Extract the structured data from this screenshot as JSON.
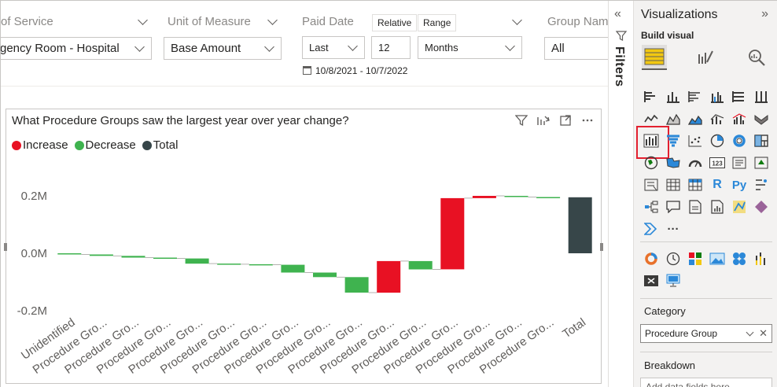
{
  "slicers": {
    "type_of_service": {
      "title": "of Service",
      "value": "gency Room - Hospital"
    },
    "unit_of_measure": {
      "title": "Unit of Measure",
      "value": "Base Amount"
    },
    "paid_date": {
      "title": "Paid Date",
      "toggle_relative": "Relative",
      "toggle_range": "Range",
      "period": "Last",
      "count": "12",
      "unit": "Months",
      "range_text": "10/8/2021 - 10/7/2022"
    },
    "group_name": {
      "title": "Group Nam",
      "value": "All"
    }
  },
  "visual": {
    "title": "What Procedure Groups saw the largest year over year change?",
    "legend": [
      {
        "label": "Increase",
        "color": "#e81123"
      },
      {
        "label": "Decrease",
        "color": "#3fb34f"
      },
      {
        "label": "Total",
        "color": "#374649"
      }
    ]
  },
  "chart_data": {
    "type": "waterfall",
    "title": "What Procedure Groups saw the largest year over year change?",
    "y_ticks": [
      "0.2M",
      "0.0M",
      "-0.2M"
    ],
    "ylim": [
      -0.2,
      0.2
    ],
    "categories": [
      "Unidentified",
      "Procedure Gro...",
      "Procedure Gro...",
      "Procedure Gro...",
      "Procedure Gro...",
      "Procedure Gro...",
      "Procedure Gro...",
      "Procedure Gro...",
      "Procedure Gro...",
      "Procedure Gro...",
      "Procedure Gro...",
      "Procedure Gro...",
      "Procedure Gro...",
      "Procedure Gro...",
      "Procedure Gro...",
      "Procedure Gro...",
      "Total"
    ],
    "bars": [
      {
        "start": 0.0,
        "end": -0.004,
        "kind": "decrease"
      },
      {
        "start": -0.004,
        "end": -0.009,
        "kind": "decrease"
      },
      {
        "start": -0.009,
        "end": -0.015,
        "kind": "decrease"
      },
      {
        "start": -0.015,
        "end": -0.018,
        "kind": "decrease"
      },
      {
        "start": -0.018,
        "end": -0.036,
        "kind": "decrease"
      },
      {
        "start": -0.036,
        "end": -0.038,
        "kind": "decrease"
      },
      {
        "start": -0.038,
        "end": -0.04,
        "kind": "decrease"
      },
      {
        "start": -0.04,
        "end": -0.067,
        "kind": "decrease"
      },
      {
        "start": -0.067,
        "end": -0.083,
        "kind": "decrease"
      },
      {
        "start": -0.083,
        "end": -0.137,
        "kind": "decrease"
      },
      {
        "start": -0.137,
        "end": -0.027,
        "kind": "increase"
      },
      {
        "start": -0.027,
        "end": -0.056,
        "kind": "decrease"
      },
      {
        "start": -0.056,
        "end": 0.192,
        "kind": "increase"
      },
      {
        "start": 0.192,
        "end": 0.2,
        "kind": "increase"
      },
      {
        "start": 0.2,
        "end": 0.196,
        "kind": "decrease"
      },
      {
        "start": 0.196,
        "end": 0.195,
        "kind": "decrease"
      },
      {
        "start": 0.0,
        "end": 0.195,
        "kind": "total"
      }
    ],
    "colors": {
      "increase": "#e81123",
      "decrease": "#3fb34f",
      "total": "#374649"
    },
    "legend": [
      "Increase",
      "Decrease",
      "Total"
    ],
    "legend_position": "top-left",
    "grid": false
  },
  "filters": {
    "label": "Filters"
  },
  "viz_pane": {
    "title": "Visualizations",
    "build_label": "Build visual",
    "category_label": "Category",
    "category_field": "Procedure Group",
    "breakdown_label": "Breakdown",
    "breakdown_placeholder": "Add data fields here",
    "more_label": "···",
    "glyphs": {
      "r": "R",
      "py": "Py",
      "card_number": "123"
    }
  }
}
